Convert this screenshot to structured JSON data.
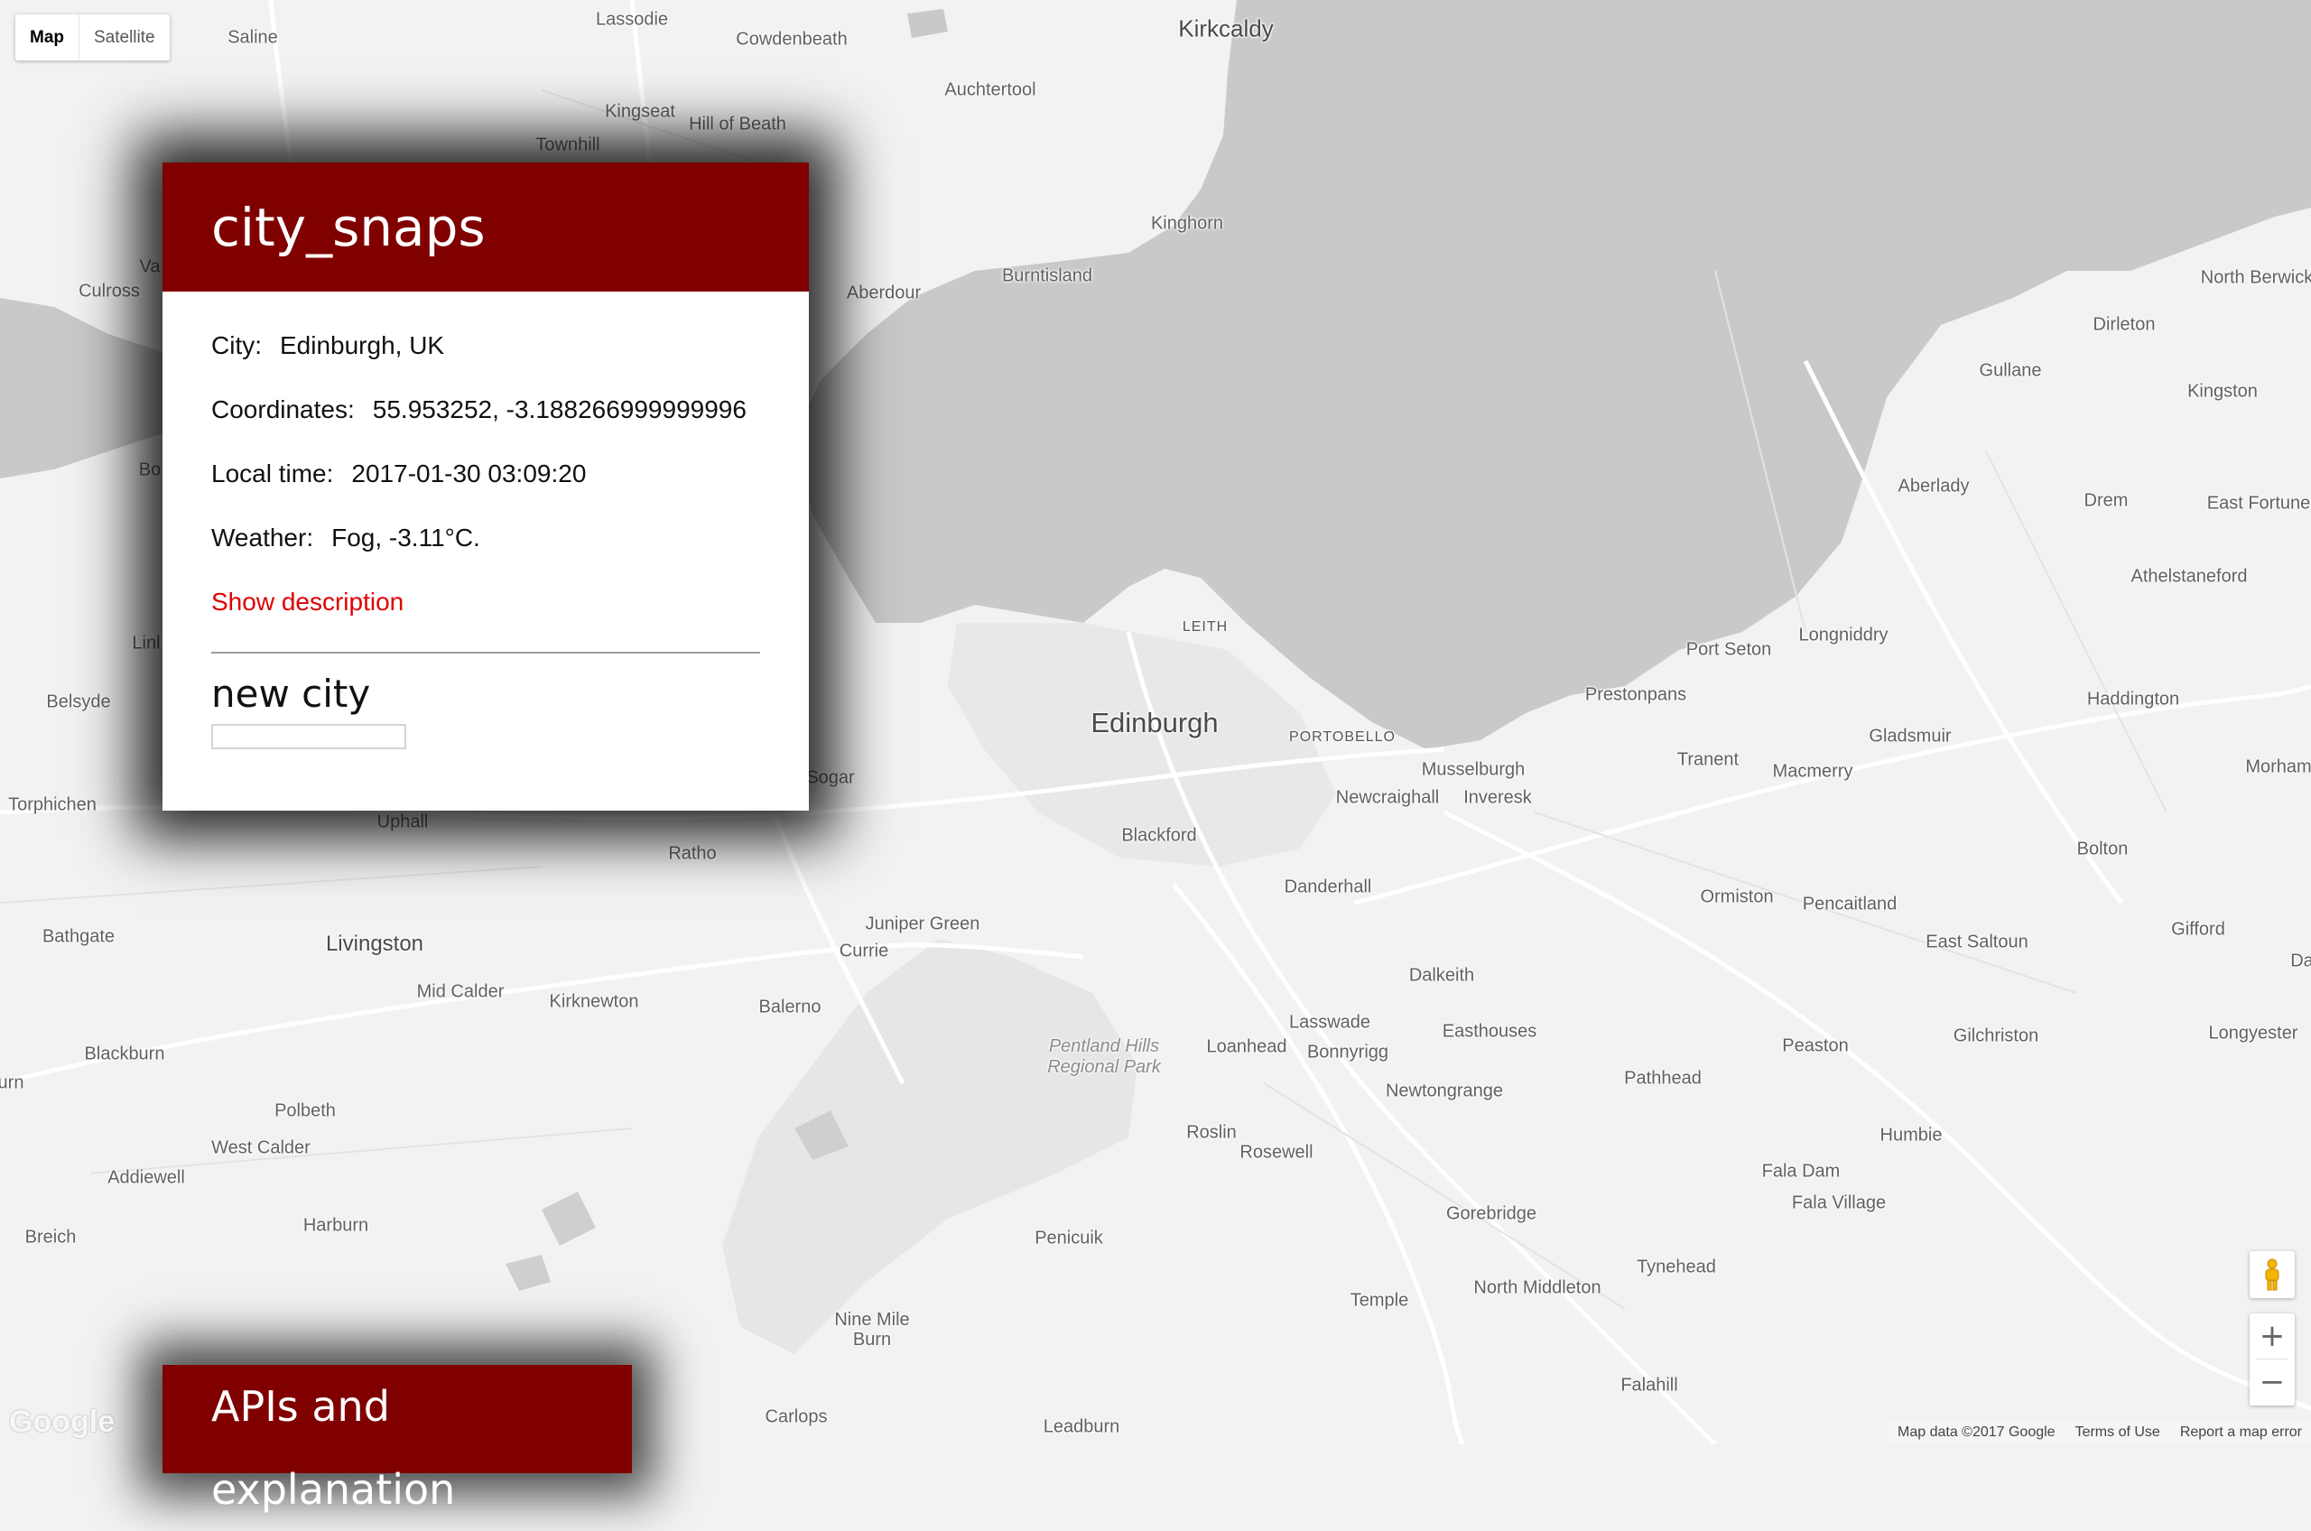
{
  "map_type": {
    "map": "Map",
    "satellite": "Satellite"
  },
  "panel": {
    "title": "city_snaps",
    "city_label": "City:",
    "city_value": "Edinburgh, UK",
    "coords_label": "Coordinates:",
    "coords_value": "55.953252, -3.188266999999996",
    "time_label": "Local time:",
    "time_value": "2017-01-30 03:09:20",
    "weather_label": "Weather:",
    "weather_value": "Fog, -3.11°C.",
    "show_description": "Show description",
    "new_city_label": "new city",
    "new_city_input_value": ""
  },
  "panel2": {
    "title": "APIs and explanation"
  },
  "attribution": {
    "map_data": "Map data ©2017 Google",
    "terms": "Terms of Use",
    "report": "Report a map error"
  },
  "google_logo": "Google",
  "map_places": [
    {
      "name": "Lassodie"
    },
    {
      "name": "Kirkcaldy"
    },
    {
      "name": "Saline"
    },
    {
      "name": "Cowdenbeath"
    },
    {
      "name": "Auchtertool"
    },
    {
      "name": "Kingseat"
    },
    {
      "name": "Hill of Beath"
    },
    {
      "name": "Townhill"
    },
    {
      "name": "Kinghorn"
    },
    {
      "name": "Burntisland"
    },
    {
      "name": "Culross"
    },
    {
      "name": "Aberdour"
    },
    {
      "name": "North Berwick"
    },
    {
      "name": "Dirleton"
    },
    {
      "name": "Gullane"
    },
    {
      "name": "Kingston"
    },
    {
      "name": "Aberlady"
    },
    {
      "name": "Drem"
    },
    {
      "name": "East Fortune"
    },
    {
      "name": "Athelstaneford"
    },
    {
      "name": "Longniddry"
    },
    {
      "name": "Port Seton"
    },
    {
      "name": "LEITH"
    },
    {
      "name": "Prestonpans"
    },
    {
      "name": "Haddington"
    },
    {
      "name": "Edinburgh"
    },
    {
      "name": "PORTOBELLO"
    },
    {
      "name": "Gladsmuir"
    },
    {
      "name": "Belsyde"
    },
    {
      "name": "Tranent"
    },
    {
      "name": "Macmerry"
    },
    {
      "name": "Musselburgh"
    },
    {
      "name": "Morham"
    },
    {
      "name": "Newcraighall"
    },
    {
      "name": "Inveresk"
    },
    {
      "name": "Torphichen"
    },
    {
      "name": "Uphall"
    },
    {
      "name": "Ratho"
    },
    {
      "name": "Blackford"
    },
    {
      "name": "Bolton"
    },
    {
      "name": "Danderhall"
    },
    {
      "name": "Ormiston"
    },
    {
      "name": "Pencaitland"
    },
    {
      "name": "Juniper Green"
    },
    {
      "name": "Bathgate"
    },
    {
      "name": "Livingston"
    },
    {
      "name": "Currie"
    },
    {
      "name": "East Saltoun"
    },
    {
      "name": "Gifford"
    },
    {
      "name": "Dalkeith"
    },
    {
      "name": "Mid Calder"
    },
    {
      "name": "Kirknewton"
    },
    {
      "name": "Balerno"
    },
    {
      "name": "Lasswade"
    },
    {
      "name": "Easthouses"
    },
    {
      "name": "Bonnyrigg"
    },
    {
      "name": "Loanhead"
    },
    {
      "name": "Peaston"
    },
    {
      "name": "Gilchriston"
    },
    {
      "name": "Longyester"
    },
    {
      "name": "Blackburn"
    },
    {
      "name": "Pathhead"
    },
    {
      "name": "Newtongrange"
    },
    {
      "name": "Polbeth"
    },
    {
      "name": "Humbie"
    },
    {
      "name": "West Calder"
    },
    {
      "name": "Roslin"
    },
    {
      "name": "Rosewell"
    },
    {
      "name": "Addiewell"
    },
    {
      "name": "Fala Dam"
    },
    {
      "name": "Fala Village"
    },
    {
      "name": "Harburn"
    },
    {
      "name": "Gorebridge"
    },
    {
      "name": "Breich"
    },
    {
      "name": "Penicuik"
    },
    {
      "name": "Tynehead"
    },
    {
      "name": "North Middleton"
    },
    {
      "name": "Temple"
    },
    {
      "name": "Nine Mile Burn"
    },
    {
      "name": "Falahill"
    },
    {
      "name": "Carlops"
    },
    {
      "name": "Leadburn"
    },
    {
      "name": "Sogar"
    },
    {
      "name": "Bo"
    },
    {
      "name": "Linl"
    },
    {
      "name": "Va"
    },
    {
      "name": "urn"
    },
    {
      "name": "Da"
    }
  ],
  "park": {
    "line1": "Pentland Hills",
    "line2": "Regional Park"
  }
}
